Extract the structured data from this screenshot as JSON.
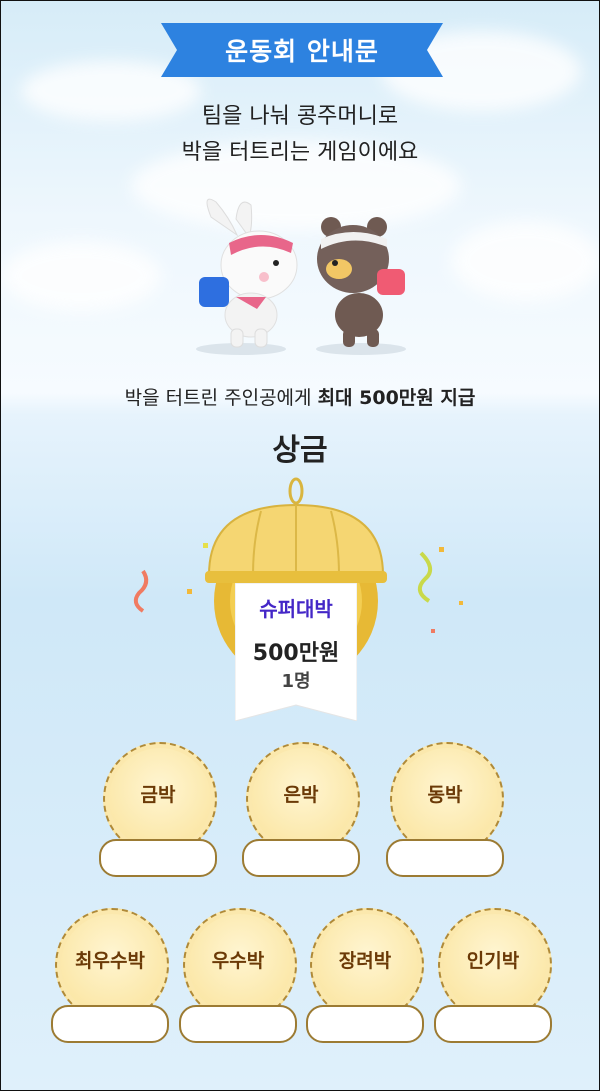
{
  "banner": {
    "title": "운동회 안내문"
  },
  "intro": {
    "line1": "팀을 나눠 콩주머니로",
    "line2": "박을 터트리는 게임이에요"
  },
  "prize_line": {
    "prefix": "박을 터트린 주인공에게 ",
    "highlight": "최대 500만원 지급"
  },
  "prizes": {
    "title": "상금",
    "super": {
      "name": "슈퍼대박",
      "amount": "500만원",
      "count": "1명"
    },
    "row1": [
      {
        "label": "금박"
      },
      {
        "label": "은박"
      },
      {
        "label": "동박"
      }
    ],
    "row2": [
      {
        "label": "최우수박"
      },
      {
        "label": "우수박"
      },
      {
        "label": "장려박"
      },
      {
        "label": "인기박"
      }
    ]
  },
  "colors": {
    "banner": "#2d82e0",
    "super_name": "#4427c7",
    "medal_text": "#6b3a07",
    "gold": "#f2c744"
  }
}
